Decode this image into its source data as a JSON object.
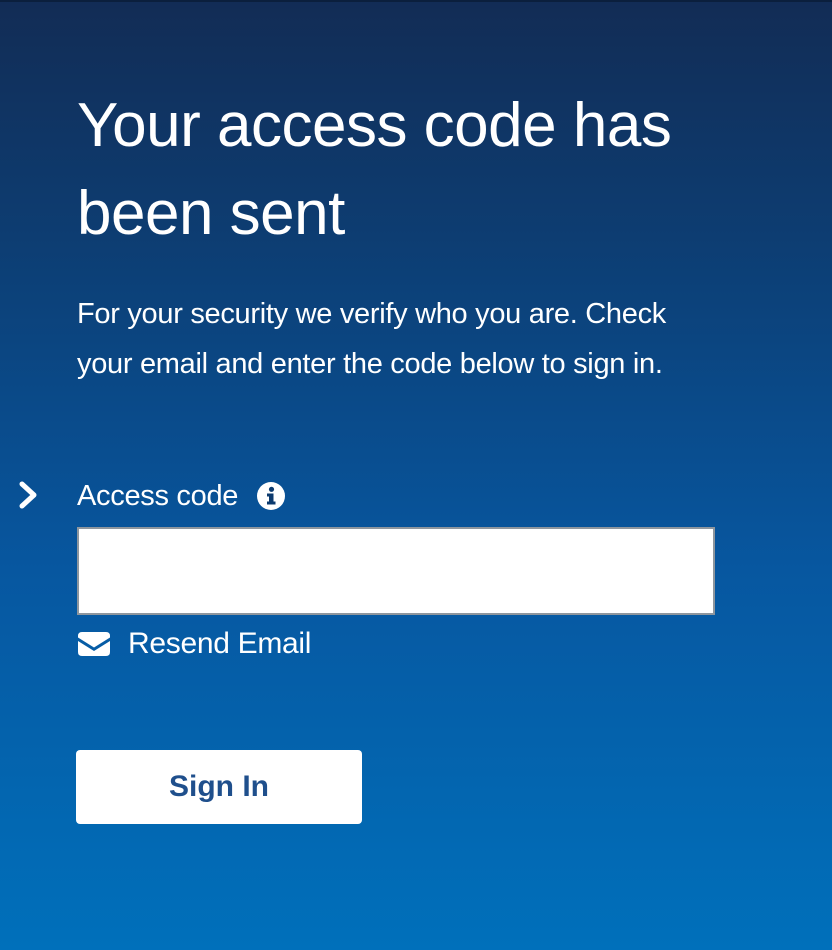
{
  "heading": "Your access code has been sent",
  "intro": "For your security we verify who you are. Check your email and enter the code below to sign in.",
  "form": {
    "access_code_label": "Access code",
    "access_code_value": "",
    "access_code_placeholder": ""
  },
  "resend_label": "Resend Email",
  "sign_in_label": "Sign In",
  "icons": {
    "indicator": "chevron-right-icon",
    "info": "info-icon",
    "mail": "envelope-icon"
  },
  "colors": {
    "background_top": "#122c55",
    "background_bottom": "#0070bb",
    "button_text": "#1f4f8c"
  }
}
